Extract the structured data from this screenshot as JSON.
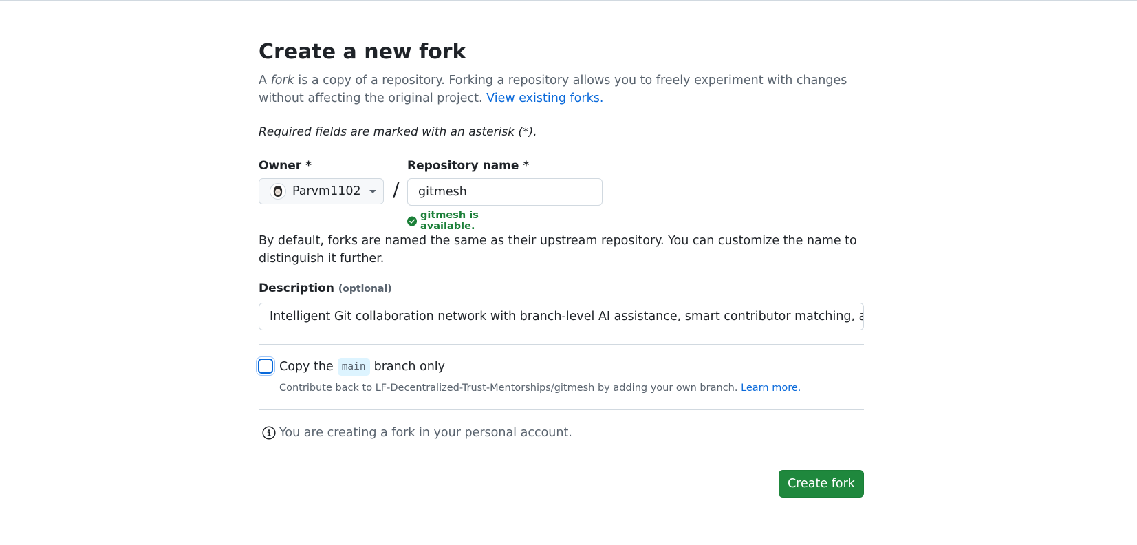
{
  "page": {
    "title": "Create a new fork",
    "intro_prefix": "A",
    "intro_italic": "fork",
    "intro_suffix": "is a copy of a repository. Forking a repository allows you to freely experiment with changes without affecting the original project.",
    "view_forks_link": "View existing forks.",
    "required_note": "Required fields are marked with an asterisk (*)."
  },
  "owner": {
    "label": "Owner *",
    "selected": "Parvm1102",
    "icon": "avatar"
  },
  "separator": "/",
  "repo": {
    "label": "Repository name *",
    "value": "gitmesh",
    "availability": "gitmesh is available.",
    "status_color": "#1a7f37"
  },
  "naming_hint": "By default, forks are named the same as their upstream repository. You can customize the name to distinguish it further.",
  "description": {
    "label": "Description",
    "optional": "(optional)",
    "value": "Intelligent Git collaboration network with branch-level AI assistance, smart contributor matching, and re"
  },
  "copy_branch": {
    "checked": false,
    "label_prefix": "Copy the",
    "branch": "main",
    "label_suffix": "branch only",
    "contribute_text": "Contribute back to LF-Decentralized-Trust-Mentorships/gitmesh by adding your own branch.",
    "learn_more": "Learn more."
  },
  "info": {
    "icon": "info-icon",
    "text": "You are creating a fork in your personal account."
  },
  "submit": {
    "label": "Create fork",
    "color": "#1f883d"
  }
}
